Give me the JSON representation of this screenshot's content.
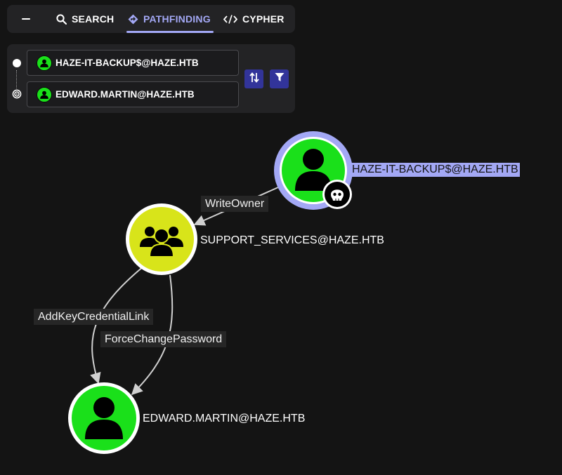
{
  "tabs": {
    "search": "SEARCH",
    "pathfinding": "PATHFINDING",
    "cypher": "CYPHER",
    "active": "pathfinding"
  },
  "pathfinding": {
    "start_value": "HAZE-IT-BACKUP$@HAZE.HTB",
    "end_value": "EDWARD.MARTIN@HAZE.HTB"
  },
  "graph": {
    "nodes": {
      "backup": {
        "label": "HAZE-IT-BACKUP$@HAZE.HTB",
        "type": "user",
        "owned": true,
        "selected": true
      },
      "support": {
        "label": "SUPPORT_SERVICES@HAZE.HTB",
        "type": "group"
      },
      "edward": {
        "label": "EDWARD.MARTIN@HAZE.HTB",
        "type": "user"
      }
    },
    "edges": {
      "writeowner": "WriteOwner",
      "addkey": "AddKeyCredentialLink",
      "forcechange": "ForceChangePassword"
    }
  },
  "colors": {
    "background": "#141414",
    "panel": "#232325",
    "accent": "#a3a8f5",
    "user_node": "#1ae01a",
    "group_node": "#d8e41a",
    "button": "#32349a"
  }
}
